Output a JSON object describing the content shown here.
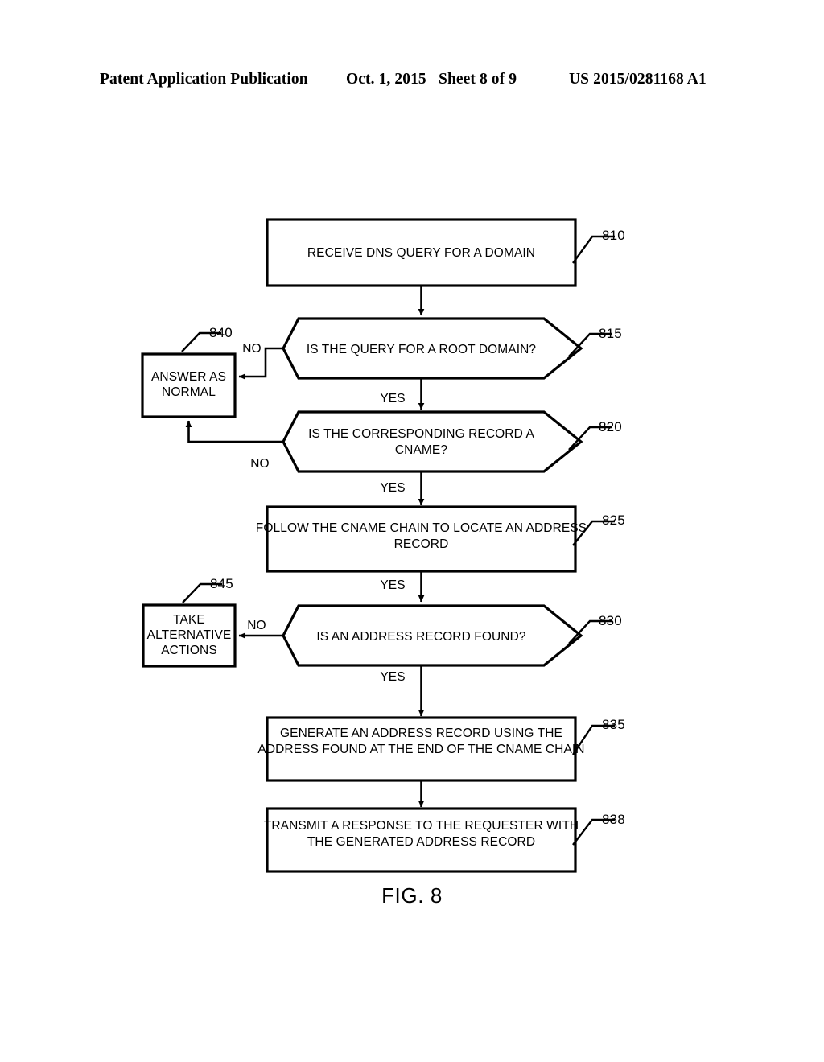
{
  "header": {
    "publication": "Patent Application Publication",
    "date": "Oct. 1, 2015",
    "sheet": "Sheet 8 of 9",
    "patent_number": "US 2015/0281168 A1"
  },
  "figure": {
    "caption": "FIG. 8",
    "type": "flowchart",
    "title": "DNS query handling for root domain CNAME resolution"
  },
  "nodes": {
    "n810": {
      "ref": "810",
      "shape": "process",
      "lines": [
        "RECEIVE DNS QUERY FOR A DOMAIN"
      ]
    },
    "n815": {
      "ref": "815",
      "shape": "decision",
      "lines": [
        "IS THE QUERY FOR A ROOT DOMAIN?"
      ]
    },
    "n820": {
      "ref": "820",
      "shape": "decision",
      "lines": [
        "IS THE CORRESPONDING RECORD A",
        "CNAME?"
      ]
    },
    "n825": {
      "ref": "825",
      "shape": "process",
      "lines": [
        "FOLLOW THE CNAME CHAIN TO LOCATE AN ADDRESS",
        "RECORD"
      ]
    },
    "n830": {
      "ref": "830",
      "shape": "decision",
      "lines": [
        "IS AN ADDRESS RECORD FOUND?"
      ]
    },
    "n835": {
      "ref": "835",
      "shape": "process",
      "lines": [
        "GENERATE AN ADDRESS RECORD USING THE",
        "ADDRESS FOUND AT THE END OF THE CNAME CHAIN"
      ]
    },
    "n838": {
      "ref": "838",
      "shape": "process",
      "lines": [
        "TRANSMIT A RESPONSE TO THE REQUESTER WITH",
        "THE GENERATED ADDRESS RECORD"
      ]
    },
    "n840": {
      "ref": "840",
      "shape": "process",
      "lines": [
        "ANSWER AS",
        "NORMAL"
      ]
    },
    "n845": {
      "ref": "845",
      "shape": "process",
      "lines": [
        "TAKE",
        "ALTERNATIVE",
        "ACTIONS"
      ]
    }
  },
  "branch_labels": {
    "b815_no": "NO",
    "b815_yes": "YES",
    "b820_no": "NO",
    "b820_yes": "YES",
    "b825_yes": "YES",
    "b830_no": "NO",
    "b830_yes": "YES"
  },
  "colors": {
    "ink": "#000000",
    "paper": "#ffffff"
  }
}
